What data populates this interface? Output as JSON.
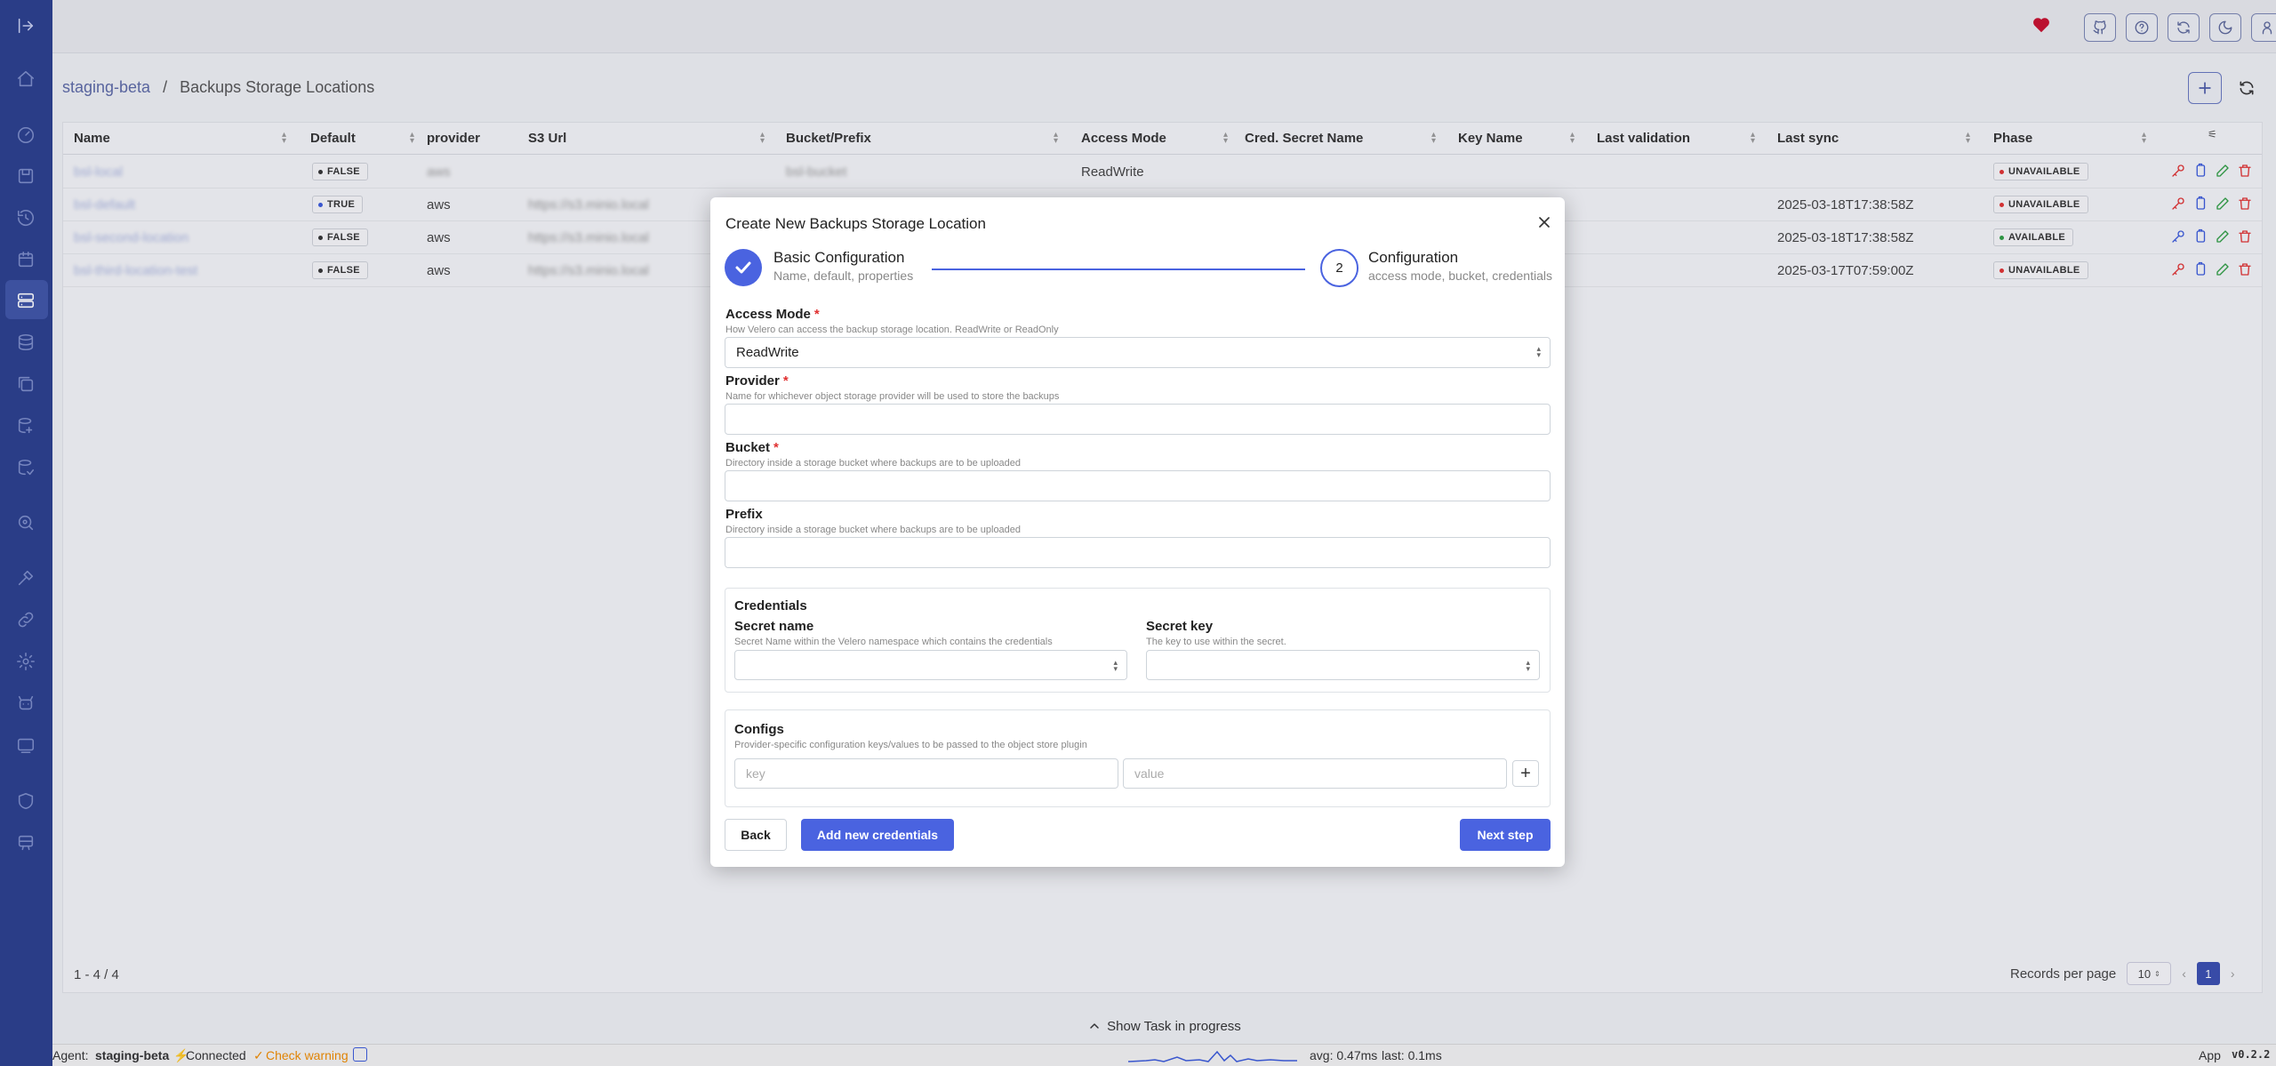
{
  "topbar": {
    "icons": [
      "sidebar-toggle-icon",
      "heart-icon",
      "github-icon",
      "help-icon",
      "refresh-icon",
      "moon-icon",
      "user-icon"
    ],
    "colors": {
      "heart": "#c8102e",
      "sidebar": "#2b3f8e",
      "accent": "#4a63e0"
    }
  },
  "sidebar": {
    "items": [
      "home-icon",
      "dashboard-icon",
      "backups-icon",
      "restores-icon",
      "schedules-icon",
      "storage-locations-icon",
      "snapshot-locations-icon",
      "repositories-icon",
      "pod-volume-backups-icon",
      "pod-volume-restores-icon",
      "inspect-icon",
      "debug-icon",
      "link-icon",
      "settings-icon",
      "agent-icon",
      "monitor-icon",
      "shield-icon",
      "server-icon"
    ],
    "active": "storage-locations-icon"
  },
  "breadcrumb": {
    "parent": "staging-beta",
    "separator": "/",
    "current": "Backups Storage Locations"
  },
  "table": {
    "columns": [
      "Name",
      "Default",
      "provider",
      "S3 Url",
      "Bucket/Prefix",
      "Access Mode",
      "Cred. Secret Name",
      "Key Name",
      "Last validation",
      "Last sync",
      "Phase"
    ],
    "rows": [
      {
        "name": "bsl-local",
        "default": "FALSE",
        "provider": "aws",
        "s3url": "",
        "bucket": "bsl-bucket",
        "access_mode": "ReadWrite",
        "last_sync": "",
        "phase": "UNAVAILABLE"
      },
      {
        "name": "bsl-default",
        "default": "TRUE",
        "provider": "aws",
        "s3url": "https://s3.minio.local",
        "bucket": "",
        "access_mode": "",
        "last_sync": "2025-03-18T17:38:58Z",
        "phase": "UNAVAILABLE"
      },
      {
        "name": "bsl-second-location",
        "default": "FALSE",
        "provider": "aws",
        "s3url": "https://s3.minio.local",
        "bucket": "",
        "access_mode": "",
        "last_sync": "2025-03-18T17:38:58Z",
        "phase": "AVAILABLE"
      },
      {
        "name": "bsl-third-location-test",
        "default": "FALSE",
        "provider": "aws",
        "s3url": "https://s3.minio.local",
        "bucket": "",
        "access_mode": "",
        "last_sync": "2025-03-17T07:59:00Z",
        "phase": "UNAVAILABLE"
      }
    ],
    "footer_count": "1 - 4 / 4",
    "records_per_page_label": "Records per page",
    "records_per_page": "10",
    "page": "1"
  },
  "taskbar": {
    "label": "Show Task in progress"
  },
  "statusbar": {
    "agent_label": "Agent:",
    "agent_name": "staging-beta",
    "connected": "Connected",
    "warning": "Check warning",
    "avg": "avg: 0.47ms",
    "last": "last: 0.1ms",
    "app": "App",
    "version": "v0.2.2"
  },
  "modal": {
    "title": "Create New Backups Storage Location",
    "step1": {
      "title": "Basic Configuration",
      "subtitle": "Name, default, properties"
    },
    "step2": {
      "number": "2",
      "title": "Configuration",
      "subtitle": "access mode, bucket, credentials"
    },
    "access_mode": {
      "label": "Access Mode",
      "required": "*",
      "description": "How Velero can access the backup storage location. ReadWrite or ReadOnly",
      "value": "ReadWrite"
    },
    "provider": {
      "label": "Provider",
      "required": "*",
      "description": "Name for whichever object storage provider will be used to store the backups",
      "value": ""
    },
    "bucket": {
      "label": "Bucket",
      "required": "*",
      "description": "Directory inside a storage bucket where backups are to be uploaded",
      "value": ""
    },
    "prefix": {
      "label": "Prefix",
      "description": "Directory inside a storage bucket where backups are to be uploaded",
      "value": ""
    },
    "credentials": {
      "title": "Credentials",
      "secret_name": {
        "label": "Secret name",
        "description": "Secret Name within the Velero namespace which contains the credentials",
        "value": ""
      },
      "secret_key": {
        "label": "Secret key",
        "description": "The key to use within the secret.",
        "value": ""
      }
    },
    "configs": {
      "title": "Configs",
      "description": "Provider-specific configuration keys/values to be passed to the object store plugin",
      "key_placeholder": "key",
      "value_placeholder": "value",
      "add": "+"
    },
    "buttons": {
      "back": "Back",
      "add_credentials": "Add new credentials",
      "next": "Next step"
    }
  }
}
